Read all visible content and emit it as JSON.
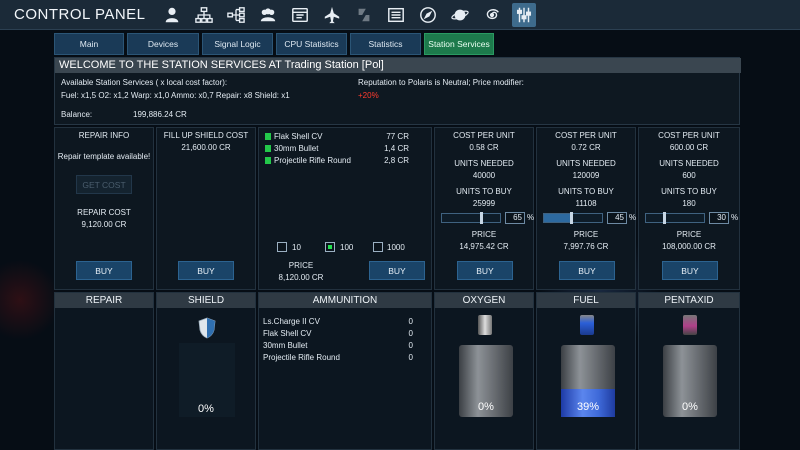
{
  "header": {
    "title": "CONTROL PANEL",
    "icons": [
      "person-icon",
      "org-chart-icon",
      "hierarchy-icon",
      "group-icon",
      "window-icon",
      "ship-icon",
      "sync-icon",
      "list-icon",
      "compass-icon",
      "planet-icon",
      "galaxy-icon",
      "sliders-icon"
    ],
    "active_icon": "sliders-icon"
  },
  "tabs": [
    {
      "label": "Main"
    },
    {
      "label": "Devices"
    },
    {
      "label": "Signal Logic"
    },
    {
      "label": "CPU Statistics"
    },
    {
      "label": "Statistics"
    },
    {
      "label": "Station Services"
    }
  ],
  "active_tab": "Station Services",
  "welcome": {
    "title": "WELCOME TO THE STATION SERVICES AT Trading Station [Pol]",
    "available_label": "Available Station Services ( x local cost factor):",
    "factors": "Fuel: x1,5  O2: x1,2  Warp: x1,0  Ammo: x0,7  Repair: x8  Shield: x1",
    "reputation": "Reputation to Polaris is Neutral; Price modifier:",
    "modifier": "+20%",
    "balance_label": "Balance:",
    "balance_value": "199,886.24 CR"
  },
  "repair": {
    "heading": "REPAIR INFO",
    "template_status": "Repair template available!",
    "get_cost_label": "GET COST",
    "cost_label": "REPAIR COST",
    "cost_value": "9,120.00 CR",
    "buy_label": "BUY"
  },
  "shield": {
    "heading": "FILL UP SHIELD COST",
    "cost_value": "21,600.00 CR",
    "buy_label": "BUY"
  },
  "ammo": {
    "items": [
      {
        "name": "Flak Shell CV",
        "price": "77 CR"
      },
      {
        "name": "30mm Bullet",
        "price": "1,4 CR"
      },
      {
        "name": "Projectile Rifle Round",
        "price": "2,8 CR"
      }
    ],
    "quantities": [
      {
        "label": "10",
        "checked": false
      },
      {
        "label": "100",
        "checked": true
      },
      {
        "label": "1000",
        "checked": false
      }
    ],
    "price_label": "PRICE",
    "price_value": "8,120.00 CR",
    "buy_label": "BUY"
  },
  "resources": [
    {
      "key": "oxygen",
      "cost_label": "COST PER UNIT",
      "cost_value": "0.58 CR",
      "needed_label": "UNITS NEEDED",
      "needed_value": "40000",
      "tobuy_label": "UNITS TO BUY",
      "tobuy_value": "25999",
      "percent": "65",
      "pct_sign": "%",
      "price_label": "PRICE",
      "price_value": "14,975.42 CR",
      "buy_label": "BUY"
    },
    {
      "key": "fuel",
      "cost_label": "COST PER UNIT",
      "cost_value": "0.72 CR",
      "needed_label": "UNITS NEEDED",
      "needed_value": "120009",
      "tobuy_label": "UNITS TO BUY",
      "tobuy_value": "11108",
      "percent": "45",
      "pct_sign": "%",
      "price_label": "PRICE",
      "price_value": "7,997.76 CR",
      "buy_label": "BUY"
    },
    {
      "key": "pentaxid",
      "cost_label": "COST PER UNIT",
      "cost_value": "600.00 CR",
      "needed_label": "UNITS NEEDED",
      "needed_value": "600",
      "tobuy_label": "UNITS TO BUY",
      "tobuy_value": "180",
      "percent": "30",
      "pct_sign": "%",
      "price_label": "PRICE",
      "price_value": "108,000.00 CR",
      "buy_label": "BUY"
    }
  ],
  "storage": {
    "repair": {
      "heading": "REPAIR"
    },
    "shield": {
      "heading": "SHIELD",
      "percent_text": "0%"
    },
    "ammunition": {
      "heading": "AMMUNITION",
      "items": [
        {
          "name": "Ls.Charge II CV",
          "count": "0"
        },
        {
          "name": "Flak Shell CV",
          "count": "0"
        },
        {
          "name": "30mm Bullet",
          "count": "0"
        },
        {
          "name": "Projectile Rifle Round",
          "count": "0"
        }
      ]
    },
    "oxygen": {
      "heading": "OXYGEN",
      "level": 0.0,
      "percent_text": "0%"
    },
    "fuel": {
      "heading": "FUEL",
      "level": 0.39,
      "percent_text": "39%"
    },
    "pentaxid": {
      "heading": "PENTAXID",
      "level": 0.0,
      "percent_text": "0%"
    }
  },
  "colors": {
    "accent_tab": "#1d7a4c",
    "modifier_red": "#ff3b2e",
    "fuel_blue": "#3e69d8"
  }
}
